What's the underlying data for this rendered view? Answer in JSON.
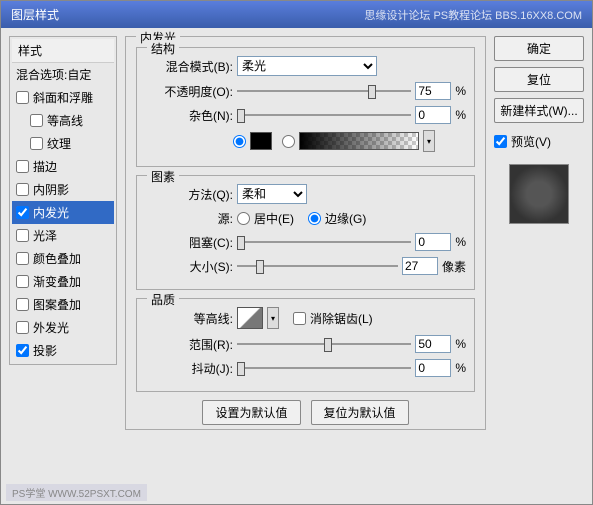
{
  "titlebar": {
    "title": "图层样式",
    "right_text": "思缘设计论坛  PS教程论坛 BBS.16XX8.COM"
  },
  "left": {
    "header": "样式",
    "blend_options": "混合选项:自定",
    "items": [
      {
        "label": "斜面和浮雕",
        "checked": false,
        "selected": false,
        "indent": false
      },
      {
        "label": "等高线",
        "checked": false,
        "selected": false,
        "indent": true
      },
      {
        "label": "纹理",
        "checked": false,
        "selected": false,
        "indent": true
      },
      {
        "label": "描边",
        "checked": false,
        "selected": false,
        "indent": false
      },
      {
        "label": "内阴影",
        "checked": false,
        "selected": false,
        "indent": false
      },
      {
        "label": "内发光",
        "checked": true,
        "selected": true,
        "indent": false
      },
      {
        "label": "光泽",
        "checked": false,
        "selected": false,
        "indent": false
      },
      {
        "label": "颜色叠加",
        "checked": false,
        "selected": false,
        "indent": false
      },
      {
        "label": "渐变叠加",
        "checked": false,
        "selected": false,
        "indent": false
      },
      {
        "label": "图案叠加",
        "checked": false,
        "selected": false,
        "indent": false
      },
      {
        "label": "外发光",
        "checked": false,
        "selected": false,
        "indent": false
      },
      {
        "label": "投影",
        "checked": true,
        "selected": false,
        "indent": false
      }
    ]
  },
  "center": {
    "panel_title": "内发光",
    "structure": {
      "title": "结构",
      "blend_mode_label": "混合模式(B):",
      "blend_mode_value": "柔光",
      "opacity_label": "不透明度(O):",
      "opacity_value": "75",
      "noise_label": "杂色(N):",
      "noise_value": "0",
      "percent": "%",
      "color_black": "#000000"
    },
    "elements": {
      "title": "图素",
      "method_label": "方法(Q):",
      "method_value": "柔和",
      "source_label": "源:",
      "source_center": "居中(E)",
      "source_edge": "边缘(G)",
      "choke_label": "阻塞(C):",
      "choke_value": "0",
      "size_label": "大小(S):",
      "size_value": "27",
      "percent": "%",
      "px": "像素"
    },
    "quality": {
      "title": "品质",
      "contour_label": "等高线:",
      "antialias_label": "消除锯齿(L)",
      "range_label": "范围(R):",
      "range_value": "50",
      "jitter_label": "抖动(J):",
      "jitter_value": "0",
      "percent": "%"
    },
    "buttons": {
      "make_default": "设置为默认值",
      "reset_default": "复位为默认值"
    }
  },
  "right": {
    "ok": "确定",
    "reset": "复位",
    "new_style": "新建样式(W)...",
    "preview_label": "预览(V)"
  },
  "watermark": "PS学堂  WWW.52PSXT.COM"
}
